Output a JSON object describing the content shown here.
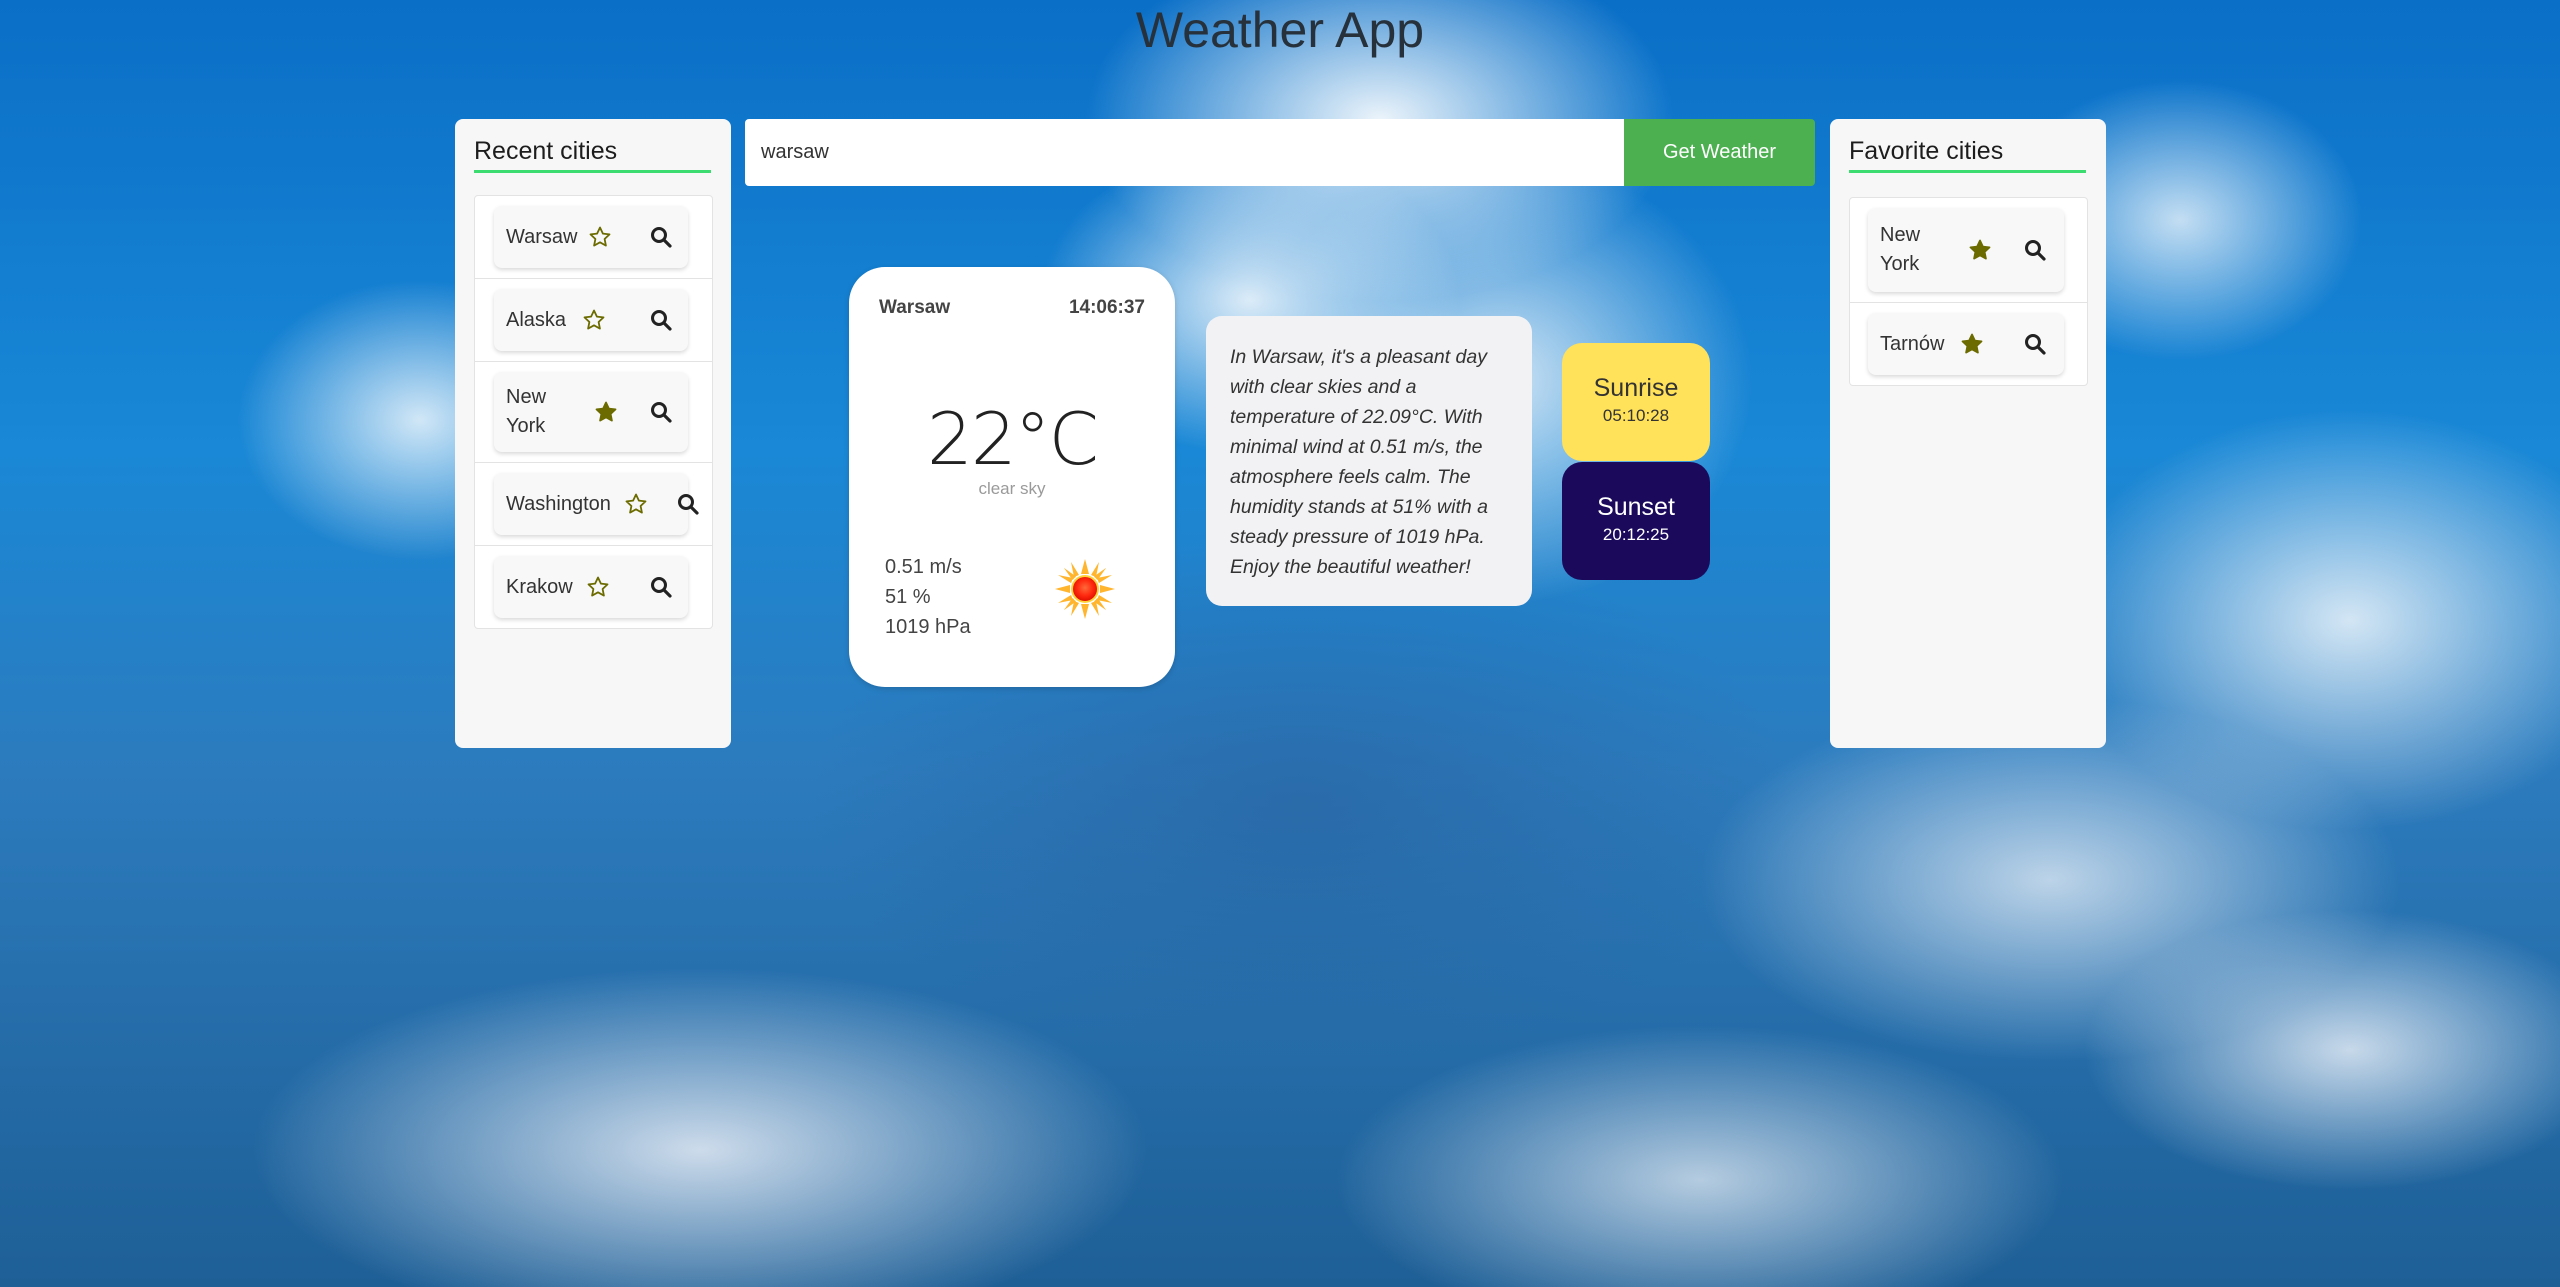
{
  "app_title": "Weather App",
  "search": {
    "value": "warsaw",
    "button_label": "Get Weather"
  },
  "recent": {
    "title": "Recent cities",
    "items": [
      {
        "name": "Warsaw",
        "favorite": false
      },
      {
        "name": "Alaska",
        "favorite": false
      },
      {
        "name": "New York",
        "favorite": true
      },
      {
        "name": "Washington",
        "favorite": false
      },
      {
        "name": "Krakow",
        "favorite": false
      }
    ]
  },
  "favorites": {
    "title": "Favorite cities",
    "items": [
      {
        "name": "New York",
        "favorite": true
      },
      {
        "name": "Tarnów",
        "favorite": true
      }
    ]
  },
  "weather": {
    "city": "Warsaw",
    "time": "14:06:37",
    "temperature": "22°C",
    "description": "clear sky",
    "wind": "0.51 m/s",
    "humidity": "51 %",
    "pressure": "1019 hPa",
    "icon": "sun-icon"
  },
  "summary": "In Warsaw, it's a pleasant day with clear skies and a temperature of 22.09°C. With minimal wind at 0.51 m/s, the atmosphere feels calm. The humidity stands at 51% with a steady pressure of 1019 hPa. Enjoy the beautiful weather!",
  "sunrise": {
    "label": "Sunrise",
    "time": "05:10:28"
  },
  "sunset": {
    "label": "Sunset",
    "time": "20:12:25"
  },
  "colors": {
    "accent_green": "#4caf50",
    "underline_green": "#3ddc70",
    "star_olive": "#6b6b00",
    "sunrise_bg": "#ffe15a",
    "sunset_bg": "#1b0a5c"
  }
}
